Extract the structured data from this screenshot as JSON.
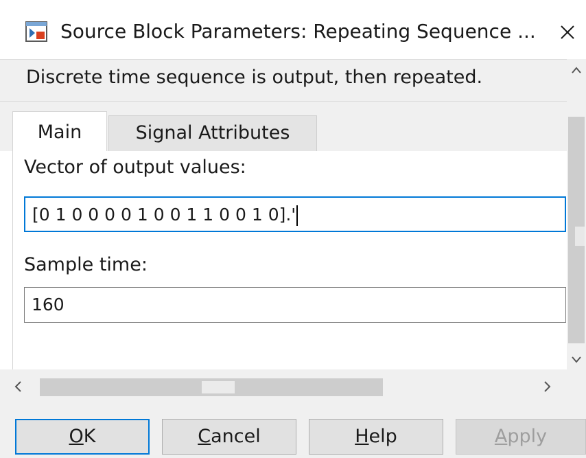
{
  "window": {
    "title": "Source Block Parameters: Repeating Sequence ...",
    "icon": "simulink-block-icon",
    "close_icon": "close-icon"
  },
  "description": "Discrete time sequence is output, then repeated.",
  "tabs": [
    {
      "label": "Main",
      "active": true
    },
    {
      "label": "Signal Attributes",
      "active": false
    }
  ],
  "fields": {
    "vector": {
      "label": "Vector of output values:",
      "value": "[0 1 0 0 0 0 1 0 0 1 1 0 0 1 0].'"
    },
    "sample_time": {
      "label": "Sample time:",
      "value": "160"
    }
  },
  "scroll": {
    "up_glyph": "^",
    "down_glyph": "v",
    "left_glyph": "<",
    "right_glyph": ">"
  },
  "buttons": {
    "ok": {
      "mnemonic": "O",
      "rest": "K"
    },
    "cancel": {
      "mnemonic": "C",
      "rest": "ancel"
    },
    "help": {
      "mnemonic": "H",
      "rest": "elp"
    },
    "apply": {
      "mnemonic": "A",
      "rest": "pply"
    }
  },
  "colors": {
    "accent": "#0078d7",
    "chrome": "#f0f0f0"
  }
}
